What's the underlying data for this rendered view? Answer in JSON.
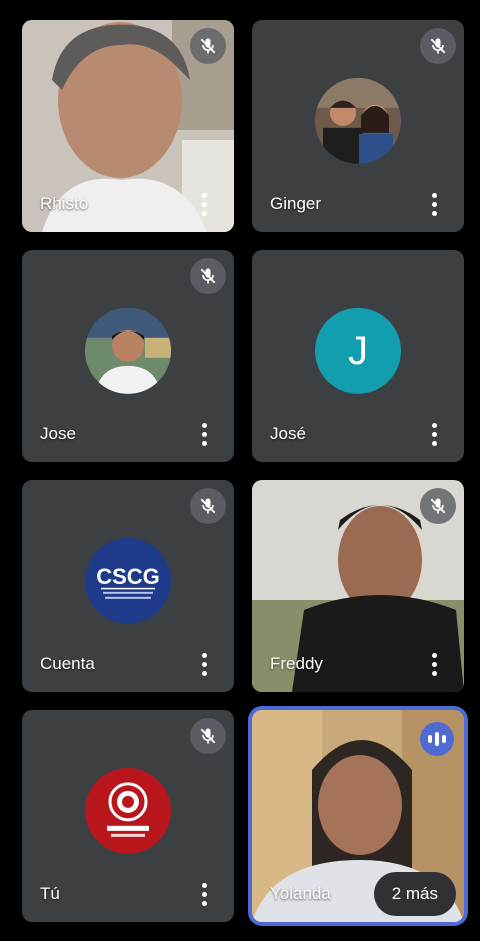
{
  "participants": [
    {
      "name": "Rhisto"
    },
    {
      "name": "Ginger"
    },
    {
      "name": "Jose"
    },
    {
      "name": "José",
      "initial": "J"
    },
    {
      "name": "Cuenta"
    },
    {
      "name": "Freddy"
    },
    {
      "name": "Tú"
    },
    {
      "name": "Yolanda"
    }
  ],
  "more_participants_label": "2 más",
  "icons": {
    "muted": "mic-off-icon",
    "options": "more-vert-icon",
    "speaking": "audio-level-icon"
  },
  "colors": {
    "tile_bg": "#3c4043",
    "accent_speaking": "#4f6bd2",
    "letter_avatar": "#129eaf"
  }
}
